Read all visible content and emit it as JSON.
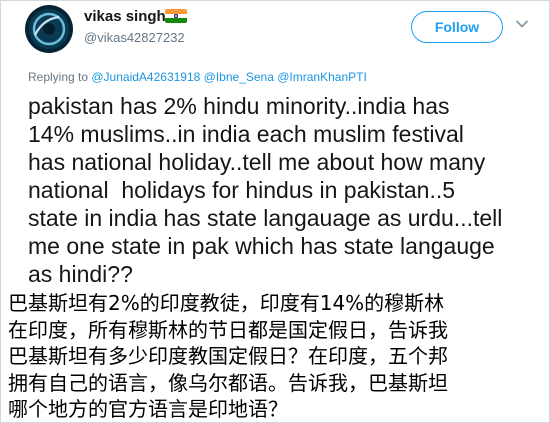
{
  "user": {
    "name": "vikas singh",
    "handle": "@vikas42827232",
    "flag_icon": "india-flag-icon"
  },
  "follow_button": {
    "label": "Follow"
  },
  "menu_icon": "chevron-down-icon",
  "reply": {
    "prefix": "Replying to ",
    "mentions": [
      "@JunaidA42631918",
      "@Ibne_Sena",
      "@ImranKhanPTI"
    ]
  },
  "tweet": {
    "lines": [
      "pakistan has 2% hindu minority..india has",
      "14% muslims..in india each muslim festival",
      "has national holiday..tell me about how many",
      "national  holidays for hindus in pakistan..5",
      "state in india has state langauage as urdu...tell",
      "me one state in pak which has state langauge",
      "as hindi??"
    ]
  },
  "translation": {
    "lines": [
      "巴基斯坦有2%的印度教徒，印度有14%的穆斯林",
      "在印度，所有穆斯林的节日都是国定假日，告诉我",
      "巴基斯坦有多少印度教国定假日？在印度，五个邦",
      "拥有自己的语言，像乌尔都语。告诉我，巴基斯坦",
      "哪个地方的官方语言是印地语？"
    ]
  },
  "colors": {
    "accent": "#1da1f2",
    "mention": "#1b95e0",
    "secondary_text": "#657786"
  }
}
